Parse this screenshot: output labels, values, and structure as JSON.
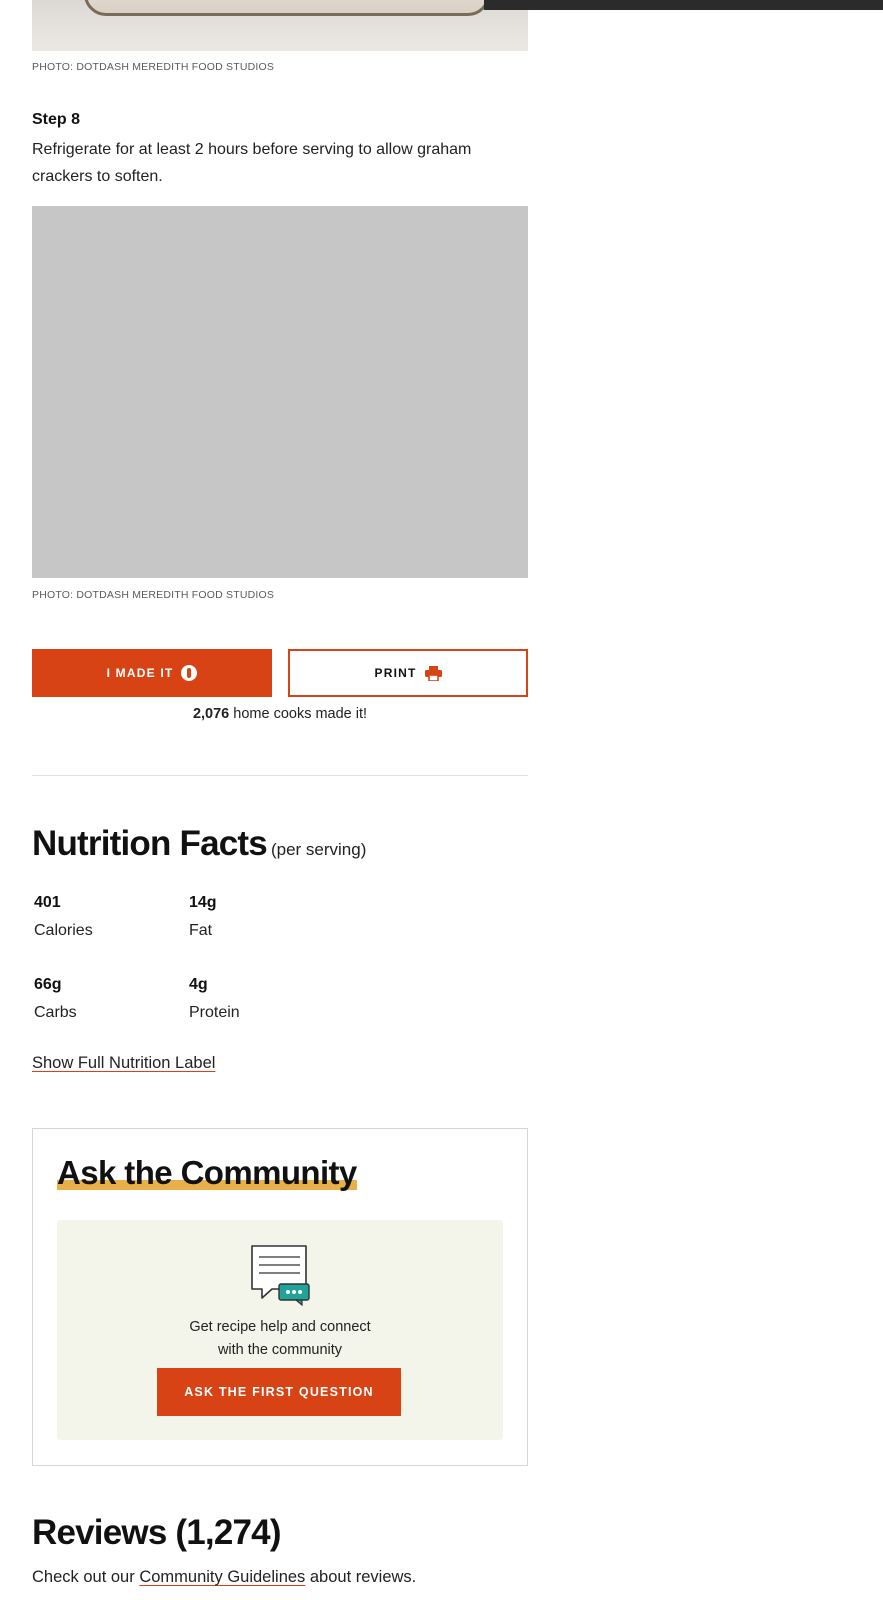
{
  "photos": {
    "top_caption": "PHOTO: DOTDASH MEREDITH FOOD STUDIOS",
    "step8_caption": "PHOTO: DOTDASH MEREDITH FOOD STUDIOS"
  },
  "step": {
    "title": "Step 8",
    "text": "Refrigerate for at least 2 hours before serving to allow graham crackers to soften."
  },
  "actions": {
    "made_it_label": "I MADE IT",
    "print_label": "PRINT",
    "made_count": "2,076",
    "made_suffix": " home cooks made it!"
  },
  "nutrition": {
    "title": "Nutrition Facts",
    "subtitle": "(per serving)",
    "facts": [
      {
        "value": "401",
        "label": "Calories"
      },
      {
        "value": "14g",
        "label": "Fat"
      },
      {
        "value": "66g",
        "label": "Carbs"
      },
      {
        "value": "4g",
        "label": "Protein"
      }
    ],
    "show_full_label": "Show Full Nutrition Label"
  },
  "community": {
    "title": "Ask the Community",
    "text_line1": "Get recipe help and connect",
    "text_line2": "with the community",
    "button_label": "ASK THE FIRST QUESTION",
    "icon": "chat-bubble-icon"
  },
  "reviews": {
    "title": "Reviews (1,274)",
    "text_prefix": "Check out our ",
    "guidelines_link": "Community Guidelines",
    "text_suffix": " about reviews."
  },
  "colors": {
    "accent": "#d84315",
    "highlight": "#e9b04a",
    "panel_bg": "#f3f4ea"
  }
}
